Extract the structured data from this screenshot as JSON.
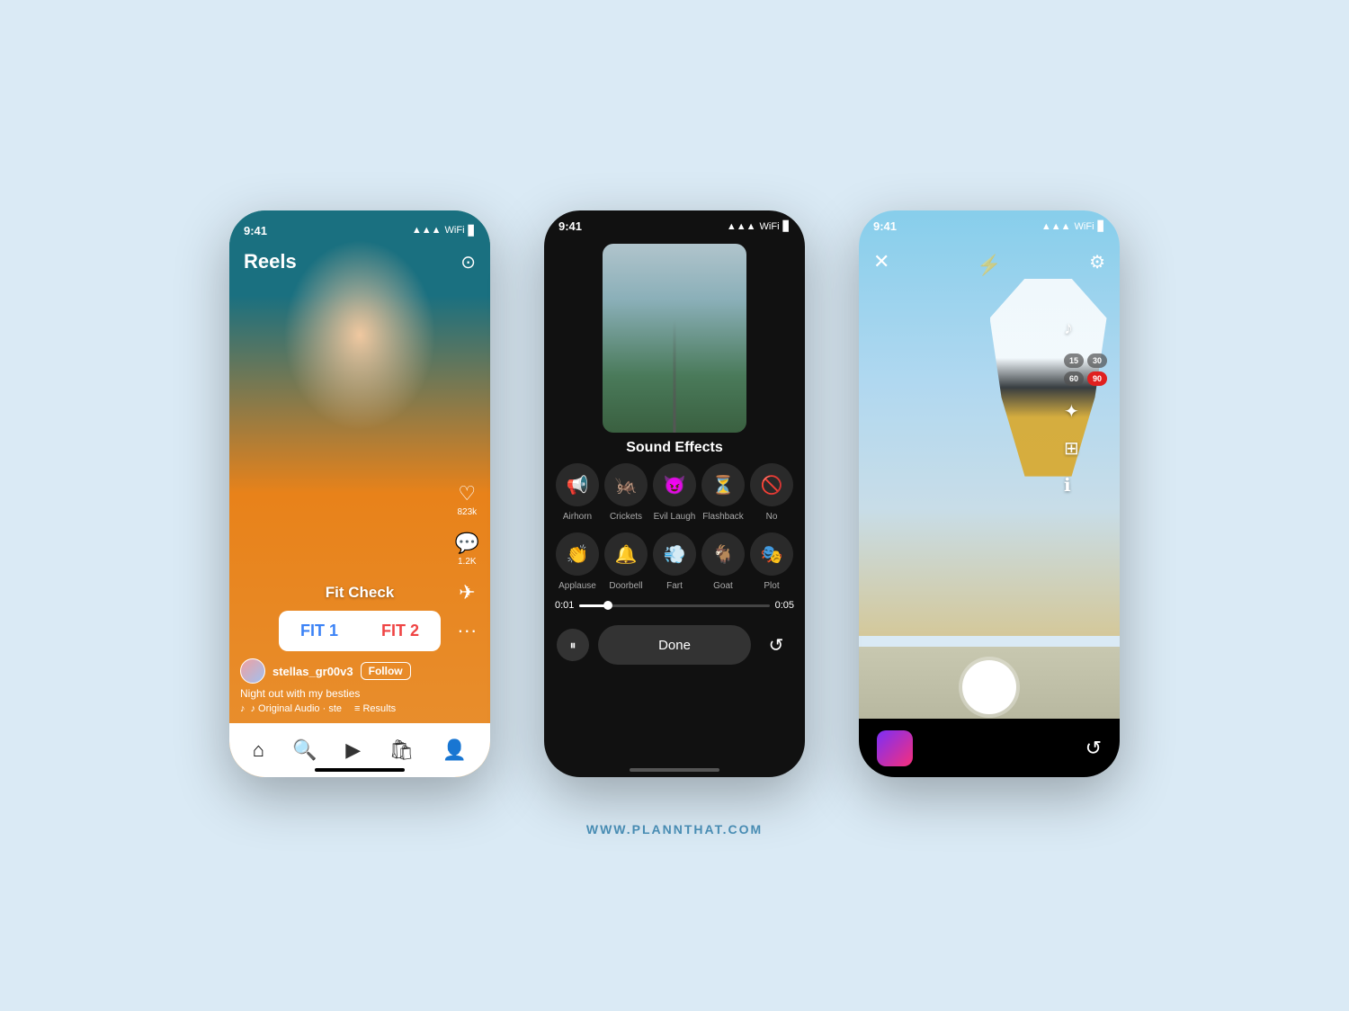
{
  "page": {
    "background": "#daeaf5",
    "website": "WWW.PLANNTHAT.COM"
  },
  "phone1": {
    "status_time": "9:41",
    "signal": "▲▲▲",
    "wifi": "WiFi",
    "battery": "🔋",
    "title": "Reels",
    "fit_check_label": "Fit Check",
    "fit1_label": "FIT 1",
    "fit2_label": "FIT 2",
    "likes": "823k",
    "comments": "1.2K",
    "username": "stellas_gr00v3",
    "follow_label": "Follow",
    "caption": "Night out with my besties",
    "audio": "♪ Original Audio · ste",
    "results": "≡ Results",
    "nav_home": "⌂",
    "nav_search": "🔍",
    "nav_reels": "▶",
    "nav_shop": "🛍",
    "nav_profile": "👤"
  },
  "phone2": {
    "status_time": "9:41",
    "title": "Sound Effects",
    "sounds_row1": [
      {
        "label": "Airhorn",
        "emoji": "📢"
      },
      {
        "label": "Crickets",
        "emoji": "🦗"
      },
      {
        "label": "Evil Laugh",
        "emoji": "😈"
      },
      {
        "label": "Flashback",
        "emoji": "⏳"
      },
      {
        "label": "No",
        "emoji": "🚫"
      }
    ],
    "sounds_row2": [
      {
        "label": "Applause",
        "emoji": "👏"
      },
      {
        "label": "Doorbell",
        "emoji": "🔔"
      },
      {
        "label": "Fart",
        "emoji": "💨"
      },
      {
        "label": "Goat",
        "emoji": "🐐"
      },
      {
        "label": "Plot",
        "emoji": "🎭"
      }
    ],
    "time_start": "0:01",
    "time_end": "0:05",
    "done_label": "Done"
  },
  "phone3": {
    "status_time": "9:41",
    "timer_options": [
      "15",
      "30",
      "60",
      "90"
    ],
    "active_timer": "90",
    "shutter": "",
    "effects_label": "Effects"
  }
}
